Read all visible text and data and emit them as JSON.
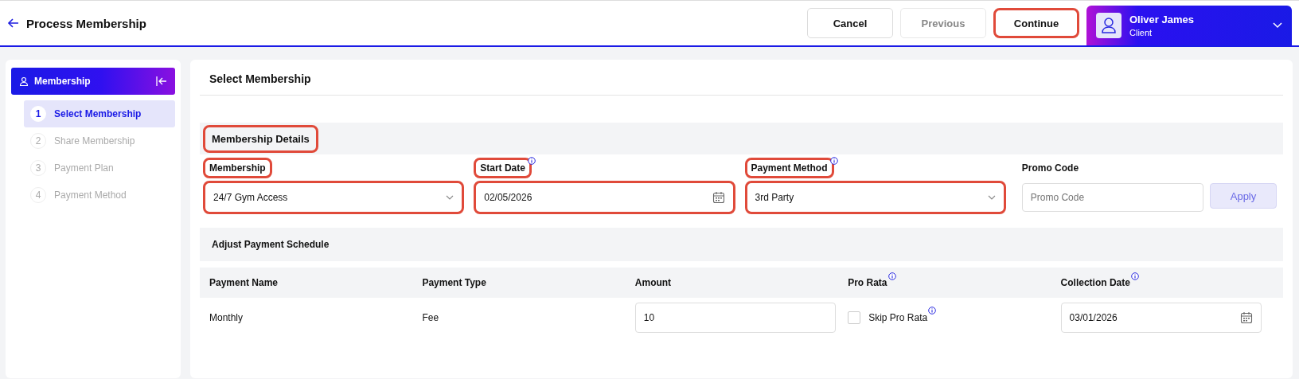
{
  "header": {
    "title": "Process Membership",
    "buttons": [
      {
        "label": "Cancel",
        "kind": "normal",
        "highlighted": false
      },
      {
        "label": "Previous",
        "kind": "disabled",
        "highlighted": false
      },
      {
        "label": "Continue",
        "kind": "normal",
        "highlighted": true
      }
    ],
    "user": {
      "name": "Oliver James",
      "role": "Client"
    }
  },
  "sidebar": {
    "title": "Membership",
    "steps": [
      {
        "number": "1",
        "label": "Select Membership",
        "selected": true
      },
      {
        "number": "2",
        "label": "Share Membership",
        "selected": false
      },
      {
        "number": "3",
        "label": "Payment Plan",
        "selected": false
      },
      {
        "number": "4",
        "label": "Payment Method",
        "selected": false
      }
    ]
  },
  "page_title": "Select Membership",
  "details": {
    "title": "Membership Details",
    "highlighted": true,
    "fields": [
      {
        "label": "Membership",
        "kind": "select",
        "value": "24/7 Gym Access",
        "info": false,
        "highlighted": true
      },
      {
        "label": "Start Date",
        "kind": "date",
        "value": "02/05/2026",
        "info": true,
        "highlighted": true
      },
      {
        "label": "Payment Method",
        "kind": "select",
        "value": "3rd Party",
        "info": true,
        "highlighted": true
      },
      {
        "label": "Promo Code",
        "kind": "promo",
        "placeholder": "Promo Code",
        "button": "Apply",
        "info": false,
        "highlighted": false
      }
    ]
  },
  "schedule": {
    "title": "Adjust Payment Schedule",
    "columns": [
      {
        "label": "Payment Name",
        "info": false
      },
      {
        "label": "Payment Type",
        "info": false
      },
      {
        "label": "Amount",
        "info": false
      },
      {
        "label": "Pro Rata",
        "info": true
      },
      {
        "label": "Collection Date",
        "info": true
      }
    ],
    "rows": [
      {
        "payment_name": "Monthly",
        "payment_type": "Fee",
        "amount": "10",
        "skip_pro_rata": {
          "label": "Skip Pro Rata",
          "checked": false
        },
        "collection_date": "03/01/2026"
      }
    ]
  }
}
